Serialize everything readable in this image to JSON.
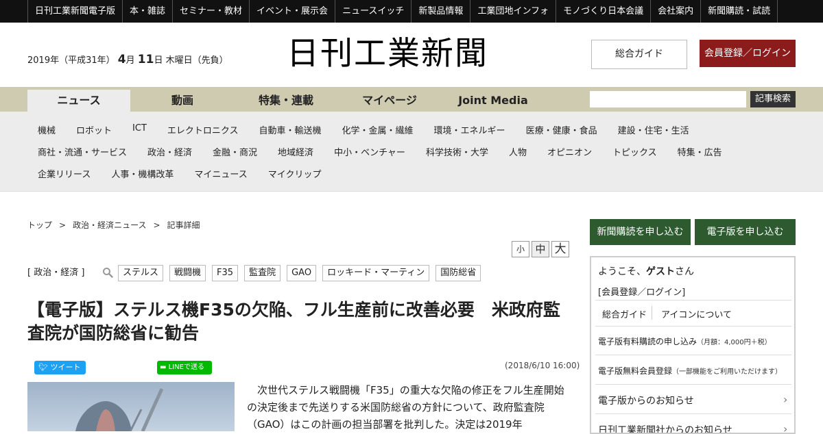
{
  "top_nav": [
    "日刊工業新聞電子版",
    "本・雑誌",
    "セミナー・教材",
    "イベント・展示会",
    "ニュースイッチ",
    "新製品情報",
    "工業団地インフォ",
    "モノづくり日本会議",
    "会社案内",
    "新聞購読・試読"
  ],
  "masthead": {
    "date_prefix": "2019年（平成31年）",
    "month": "4",
    "month_unit": "月",
    "day": "11",
    "day_suffix": "日 木曜日（先負）",
    "logo": "日刊工業新聞",
    "guide_button": "総合ガイド",
    "login_button": "会員登録／ログイン"
  },
  "main_nav": {
    "tabs": [
      "ニュース",
      "動画",
      "特集・連載",
      "マイページ",
      "Joint Media"
    ],
    "search_button": "記事検索"
  },
  "categories": {
    "row1": [
      "機械",
      "ロボット",
      "ICT",
      "エレクトロニクス",
      "自動車・輸送機",
      "化学・金属・繊維",
      "環境・エネルギー",
      "医療・健康・食品",
      "建設・住宅・生活"
    ],
    "row2": [
      "商社・流通・サービス",
      "政治・経済",
      "金融・商況",
      "地域経済",
      "中小・ベンチャー",
      "科学技術・大学",
      "人物",
      "オピニオン",
      "トピックス",
      "特集・広告"
    ],
    "row3": [
      "企業リリース",
      "人事・機構改革",
      "マイニュース",
      "マイクリップ"
    ]
  },
  "breadcrumb": {
    "top": "トップ",
    "section": "政治・経済ニュース",
    "current": "記事詳細",
    "sep": ">"
  },
  "font_size": {
    "small": "小",
    "medium": "中",
    "large": "大"
  },
  "article": {
    "category": "[ 政治・経済 ]",
    "tags": [
      "ステルス",
      "戦闘機",
      "F35",
      "監査院",
      "GAO",
      "ロッキード・マーティン",
      "国防総省"
    ],
    "headline": "【電子版】ステルス機F35の欠陥、フル生産前に改善必要　米政府監査院が国防総省に勧告",
    "tweet_label": "ツイート",
    "line_label": "LINEで送る",
    "date": "(2018/6/10 16:00)",
    "body": "次世代ステルス戦闘機「F35」の重大な欠陥の修正をフル生産開始の決定後まで先送りする米国防総省の方針について、政府監査院（GAO）はこの計画の担当部署を批判した。決定は2019年"
  },
  "sidebar": {
    "subscribe_button": "新聞購読を申し込む",
    "digital_button": "電子版を申し込む",
    "welcome_prefix": "ようこそ、",
    "guest": "ゲスト",
    "welcome_suffix": "さん",
    "register_link": "[会員登録／ログイン]",
    "guide_link": "総合ガイド",
    "icons_link": "アイコンについて",
    "paid_label": "電子版有料購読の申し込み",
    "paid_note": "（月額：4,000円＋税）",
    "free_label": "電子版無料会員登録",
    "free_note": "（一部機能をご利用いただけます）",
    "notice1": "電子版からのお知らせ",
    "notice2": "日刊工業新聞社からのお知らせ"
  },
  "colors": {
    "top_bar": "#111111",
    "nav_bar": "#cfcbb1",
    "login_button": "#8c1c1c",
    "sidebar_button": "#2d5b2f",
    "twitter": "#1da1f2",
    "line": "#00b900"
  }
}
